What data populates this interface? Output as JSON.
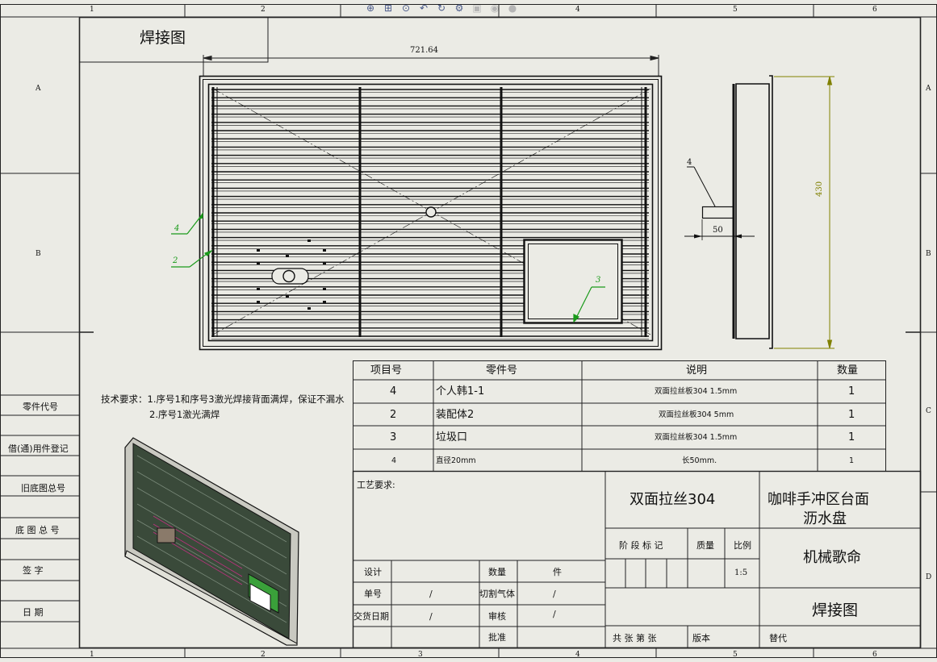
{
  "toolbar": {
    "buttons": [
      {
        "name": "zoom-to-fit-icon",
        "glyph": "⊕"
      },
      {
        "name": "zoom-area-icon",
        "glyph": "⊞"
      },
      {
        "name": "zoom-in-out-icon",
        "glyph": "⊙"
      },
      {
        "name": "previous-view-icon",
        "glyph": "↶"
      },
      {
        "name": "rebuild-icon",
        "glyph": "↻"
      },
      {
        "name": "view-settings-icon",
        "glyph": "⚙"
      },
      {
        "name": "display-style-icon",
        "glyph": "▣"
      },
      {
        "name": "hide-show-icon",
        "glyph": "◉"
      },
      {
        "name": "appearance-icon",
        "glyph": "●"
      }
    ]
  },
  "zones": {
    "columns": [
      "1",
      "2",
      "3",
      "4",
      "5",
      "6"
    ],
    "rows": [
      "A",
      "B",
      "C",
      "D"
    ]
  },
  "drawing_title": "焊接图",
  "dimensions": {
    "width": "721.64",
    "height": "430",
    "bracket_length": "50"
  },
  "balloons": {
    "front_4": "4",
    "front_2": "2",
    "front_3": "3",
    "side_4": "4"
  },
  "tech_requirements": {
    "line1": "技术要求：1.序号1和序号3激光焊接背面满焊，保证不漏水",
    "line2": "2.序号1激光满焊"
  },
  "left_labels": [
    "零件代号",
    "借(通)用件登记",
    "旧底图总号",
    "底 图 总 号",
    "签    字",
    "日    期"
  ],
  "bom": {
    "headers": [
      "项目号",
      "零件号",
      "说明",
      "数量"
    ],
    "rows": [
      {
        "item": "4",
        "part": "个人韩1-1",
        "desc": "双面拉丝板304 1.5mm",
        "qty": "1"
      },
      {
        "item": "2",
        "part": "装配体2",
        "desc": "双面拉丝板304 5mm",
        "qty": "1"
      },
      {
        "item": "3",
        "part": "垃圾口",
        "desc": "双面拉丝板304 1.5mm",
        "qty": "1"
      },
      {
        "item": "4",
        "part": "直径20mm",
        "desc": "长50mm.",
        "qty": "1"
      }
    ]
  },
  "title_block": {
    "process_req": "工艺要求:",
    "material": "双面拉丝304",
    "part_name_1": "咖啡手冲区台面",
    "part_name_2": "沥水盘",
    "company": "机械歌命",
    "drawing_name": "焊接图",
    "stage_label": "阶 段 标 记",
    "mass_label": "质量",
    "scale_label": "比例",
    "scale_value": "1:5",
    "design_label": "设计",
    "quantity_label": "数量",
    "quantity_unit": "件",
    "unit_label": "单号",
    "unit_value": "/",
    "cutting_gas_label": "切割气体",
    "cutting_gas_value": "/",
    "delivery_label": "交货日期",
    "delivery_value": "/",
    "review_label": "审核",
    "review_value": "/",
    "approve_label": "批准",
    "sheets_label": "共  张  第  张",
    "version_label": "版本",
    "replace_label": "替代"
  }
}
